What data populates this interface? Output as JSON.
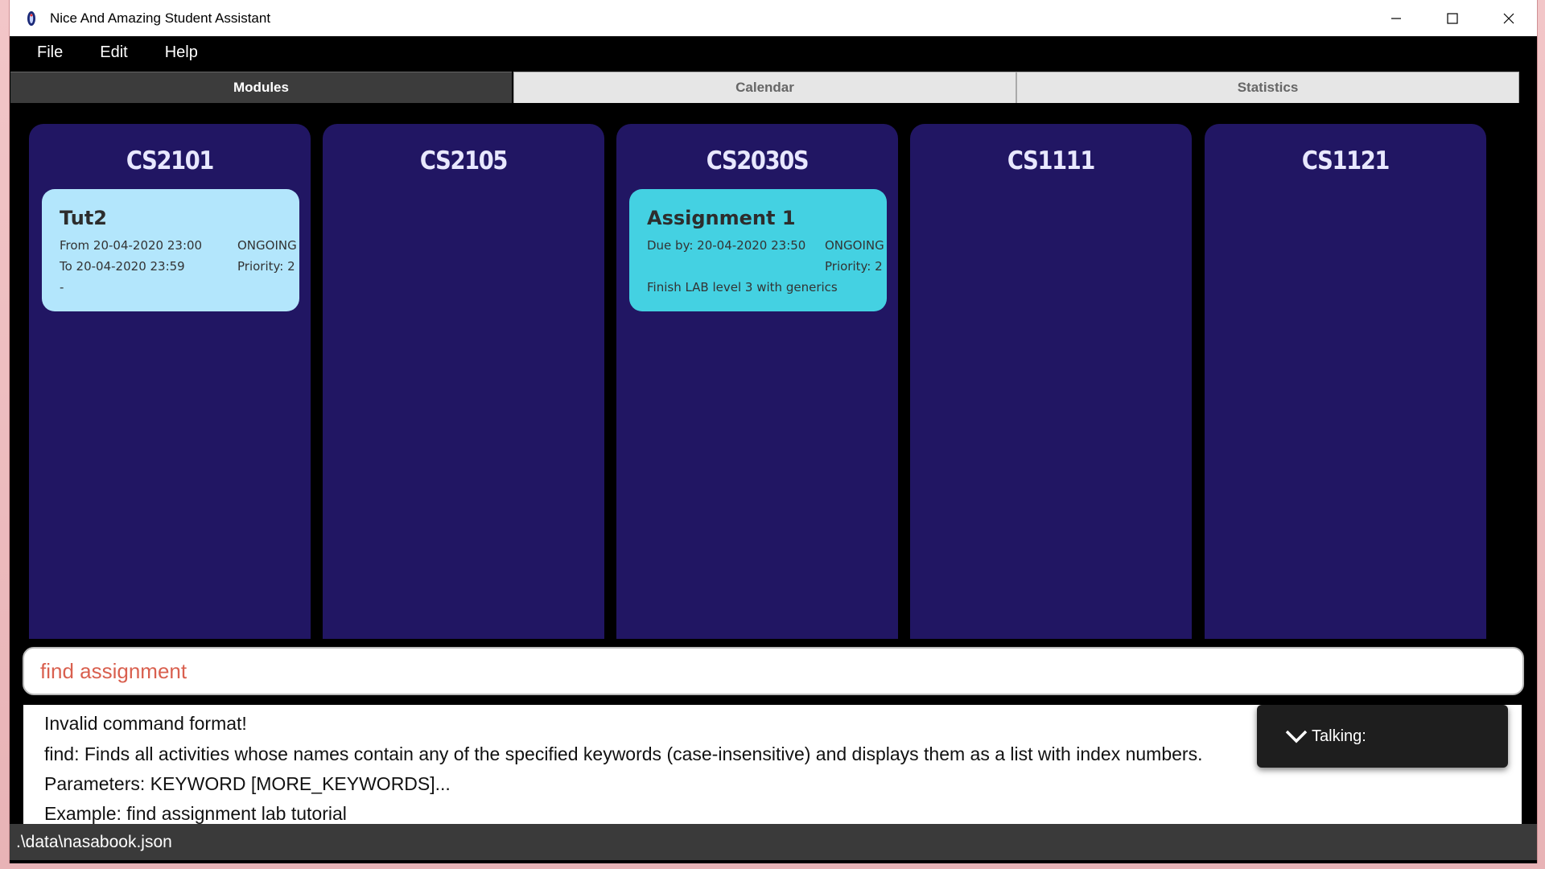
{
  "window": {
    "title": "Nice And Amazing Student Assistant"
  },
  "menu": {
    "items": [
      "File",
      "Edit",
      "Help"
    ]
  },
  "tabs": [
    {
      "label": "Modules",
      "active": true
    },
    {
      "label": "Calendar",
      "active": false
    },
    {
      "label": "Statistics",
      "active": false
    }
  ],
  "modules": [
    {
      "code": "CS2101",
      "activity": {
        "title": "Tut2",
        "line1_left": "From 20-04-2020 23:00",
        "line1_right": "ONGOING",
        "line2_left": "To 20-04-2020 23:59",
        "line2_right": "Priority: 2",
        "line3": "-",
        "color": "#b3e6fc"
      }
    },
    {
      "code": "CS2105"
    },
    {
      "code": "CS2030S",
      "activity": {
        "title": "Assignment 1",
        "line1_left": "Due by: 20-04-2020 23:50",
        "line1_right": "ONGOING",
        "line2_right": "Priority: 2",
        "line3": "Finish LAB level 3 with generics",
        "color": "#44d1e2"
      }
    },
    {
      "code": "CS1111"
    },
    {
      "code": "CS1121"
    }
  ],
  "command": {
    "value": "find assignment"
  },
  "result": {
    "lines": [
      "Invalid command format!",
      "find: Finds all activities whose names contain any of the specified keywords (case-insensitive) and displays them as a list with index numbers.",
      "Parameters: KEYWORD [MORE_KEYWORDS]...",
      "Example: find assignment lab tutorial"
    ]
  },
  "talking": {
    "label": "Talking:"
  },
  "status": {
    "path": ".\\data\\nasabook.json"
  },
  "colors": {
    "module_background": "#211663",
    "command_text": "#d9604f"
  }
}
